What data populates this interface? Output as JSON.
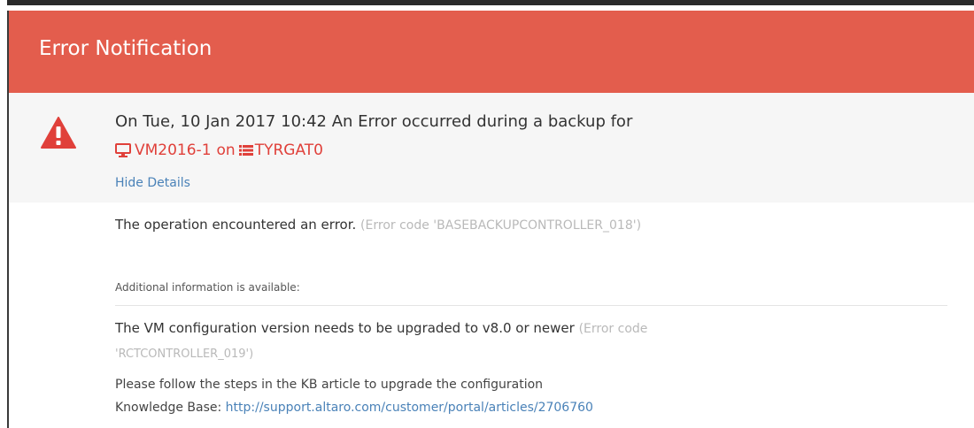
{
  "header": {
    "title": "Error Notification",
    "color": "#e35d4d"
  },
  "summary": {
    "icon": "warning-triangle-icon",
    "message": "On Tue, 10 Jan 2017 10:42 An Error occurred during a backup for",
    "vm_icon": "monitor-icon",
    "vm_name": "VM2016-1",
    "on_word": "on",
    "host_icon": "server-list-icon",
    "host_name": "TYRGAT0",
    "hide_details_label": "Hide Details"
  },
  "details": {
    "main_error": "The operation encountered an error.",
    "main_error_code": "(Error code 'BASEBACKUPCONTROLLER_018')",
    "additional_label": "Additional information is available:",
    "vm_error": "The VM configuration version needs to be upgraded to v8.0 or newer",
    "vm_error_code_part1": "(Error code",
    "vm_error_code_part2": "'RCTCONTROLLER_019')",
    "steps_text": "Please follow the steps in the KB article to upgrade the configuration",
    "kb_label": "Knowledge Base:",
    "kb_link": "http://support.altaro.com/customer/portal/articles/2706760"
  },
  "colors": {
    "accent_red": "#e0403a",
    "link_blue": "#4a82b8",
    "muted_gray": "#b9b9b9"
  }
}
